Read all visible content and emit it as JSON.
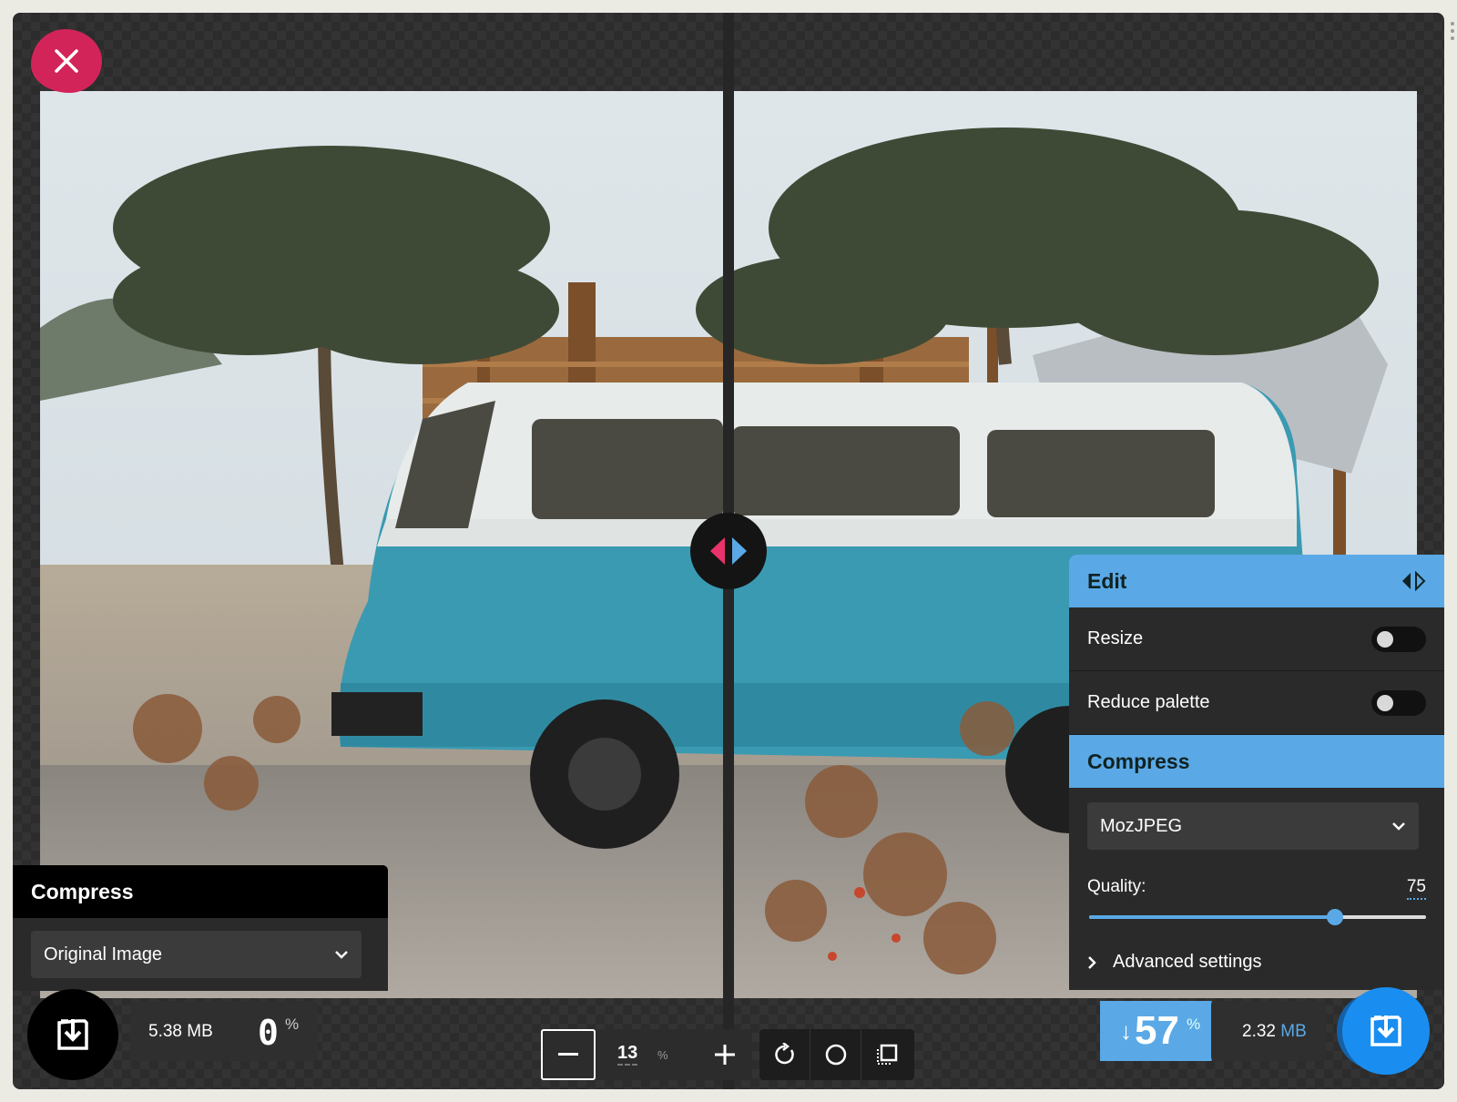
{
  "close_button": {
    "icon": "close-icon",
    "color": "#d3245a"
  },
  "left_panel": {
    "title": "Compress",
    "select_value": "Original Image"
  },
  "left_stats": {
    "size_value": "5.38 MB",
    "percent": "0",
    "percent_symbol": "%"
  },
  "right_panel": {
    "edit_title": "Edit",
    "resize_label": "Resize",
    "reduce_palette_label": "Reduce palette",
    "compress_title": "Compress",
    "codec_value": "MozJPEG",
    "quality_label": "Quality:",
    "quality_value": "75",
    "quality_level": 0.73,
    "advanced_label": "Advanced settings",
    "accent": "#5aa9e6"
  },
  "zoom": {
    "value": "13",
    "unit": "%"
  },
  "right_stats": {
    "arrow": "↓",
    "savings": "57",
    "percent_symbol": "%",
    "size_number": "2.32",
    "size_unit": "MB"
  }
}
